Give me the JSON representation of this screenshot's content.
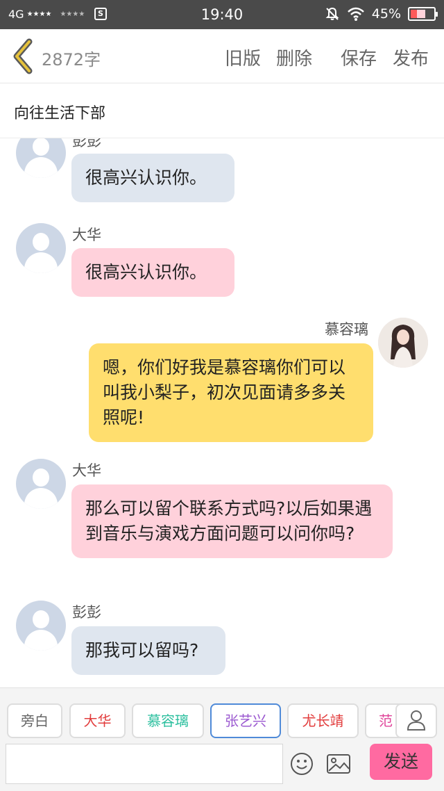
{
  "status_bar": {
    "network": "4G",
    "time": "19:40",
    "battery_percent": "45%",
    "battery_level": 0.45,
    "battery_color": "#ff5a5a"
  },
  "header": {
    "word_count": "2872字",
    "actions": {
      "old_version": "旧版",
      "delete": "删除",
      "save": "保存",
      "publish": "发布"
    },
    "back_icon": "chevron-left-icon",
    "back_color": "#e6c23c"
  },
  "story": {
    "title": "向往生活下部"
  },
  "messages": [
    {
      "sender": "彭彭",
      "text": "很高兴认识你。",
      "side": "left",
      "bubble_color": "#dfe6ef"
    },
    {
      "sender": "大华",
      "text": "很高兴认识你。",
      "side": "left",
      "bubble_color": "#ffd1db"
    },
    {
      "sender": "慕容璃",
      "text": "嗯，你们好我是慕容璃你们可以叫我小梨子，初次见面请多多关照呢!",
      "side": "right",
      "bubble_color": "#ffde6e"
    },
    {
      "sender": "大华",
      "text": "那么可以留个联系方式吗?以后如果遇到音乐与演戏方面问题可以问你吗?",
      "side": "left",
      "bubble_color": "#ffd1db"
    },
    {
      "sender": "彭彭",
      "text": "那我可以留吗?",
      "side": "left",
      "bubble_color": "#dfe6ef"
    }
  ],
  "characters": [
    {
      "label": "旁白",
      "color": "#666666"
    },
    {
      "label": "大华",
      "color": "#e23c3c"
    },
    {
      "label": "慕容璃",
      "color": "#2bbf9e"
    },
    {
      "label": "张艺兴",
      "color": "#9b59d0",
      "selected": true
    },
    {
      "label": "尤长靖",
      "color": "#e23c3c"
    },
    {
      "label": "范",
      "color": "#e0449a"
    }
  ],
  "composer": {
    "input_value": "",
    "send_label": "发送",
    "send_color": "#ff6aa1",
    "icons": [
      "emoji-icon",
      "image-icon",
      "person-icon"
    ]
  }
}
